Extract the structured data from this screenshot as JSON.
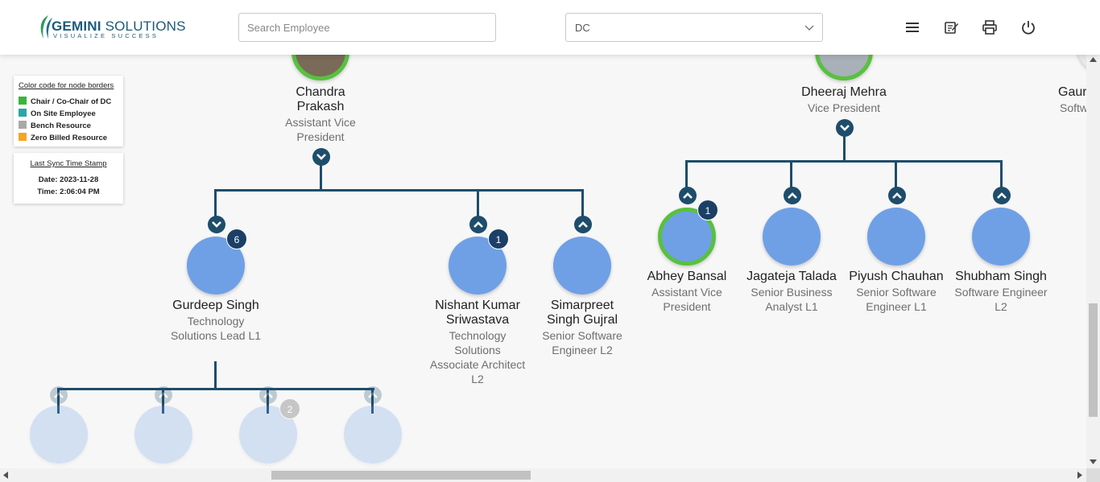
{
  "brand": {
    "name": "GEMINI",
    "name2": "SOLUTIONS",
    "tagline": "VISUALIZE SUCCESS"
  },
  "search": {
    "placeholder": "Search Employee"
  },
  "dc_select": {
    "value": "DC"
  },
  "header_icons": [
    "menu-icon",
    "notes-icon",
    "print-icon",
    "power-icon"
  ],
  "legend": {
    "title": "Color code for node borders",
    "items": [
      {
        "label": "Chair / Co-Chair of DC",
        "color": "#3ab53a"
      },
      {
        "label": "On Site Employee",
        "color": "#2aa6a6"
      },
      {
        "label": "Bench Resource",
        "color": "#a9a9a9"
      },
      {
        "label": "Zero Billed Resource",
        "color": "#f5a623"
      }
    ]
  },
  "sync": {
    "title": "Last Sync Time Stamp",
    "date": "Date: 2023-11-28",
    "time": "Time: 2:06:04 PM"
  },
  "nodes": {
    "chandra": {
      "name1": "Chandra",
      "name2": "Prakash",
      "role1": "Assistant Vice",
      "role2": "President"
    },
    "dheeraj": {
      "name": "Dheeraj Mehra",
      "role": "Vice President"
    },
    "gaur": {
      "name": "Gaur",
      "role": "Softw"
    },
    "gurdeep": {
      "name": "Gurdeep Singh",
      "role1": "Technology",
      "role2": "Solutions Lead L1",
      "badge": "6"
    },
    "nishant": {
      "name1": "Nishant Kumar",
      "name2": "Sriwastava",
      "role1": "Technology",
      "role2": "Solutions",
      "role3": "Associate Architect",
      "role4": "L2",
      "badge": "1"
    },
    "simarpreet": {
      "name1": "Simarpreet",
      "name2": "Singh Gujral",
      "role1": "Senior Software",
      "role2": "Engineer L2"
    },
    "abhey": {
      "name": "Abhey Bansal",
      "role1": "Assistant Vice",
      "role2": "President",
      "badge": "1"
    },
    "jagateja": {
      "name": "Jagateja Talada",
      "role1": "Senior Business",
      "role2": "Analyst L1"
    },
    "piyush": {
      "name": "Piyush Chauhan",
      "role1": "Senior Software",
      "role2": "Engineer L1"
    },
    "shubham": {
      "name": "Shubham Singh",
      "role1": "Software Engineer",
      "role2": "L2"
    },
    "faded_badge": "2"
  }
}
